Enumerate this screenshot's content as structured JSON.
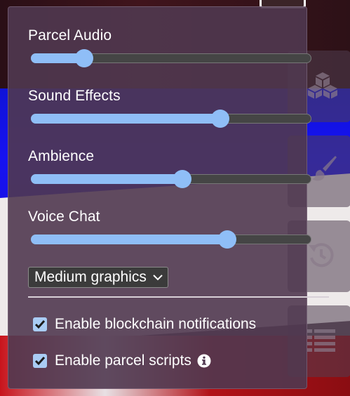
{
  "sliders": [
    {
      "label": "Parcel Audio",
      "value": 0.19
    },
    {
      "label": "Sound Effects",
      "value": 0.675
    },
    {
      "label": "Ambience",
      "value": 0.54
    },
    {
      "label": "Voice Chat",
      "value": 0.7
    }
  ],
  "graphics_select": {
    "value": "Medium graphics"
  },
  "checkboxes": [
    {
      "label": "Enable blockchain notifications",
      "checked": true
    },
    {
      "label": "Enable parcel scripts",
      "checked": true,
      "icon": "info-icon"
    }
  ],
  "toolbar": {
    "icons": [
      "cubes-icon",
      "paintbrush-icon",
      "history-icon",
      "list-icon"
    ]
  },
  "colors": {
    "accent": "#8fbef7",
    "panel": "#503850",
    "track": "#454545"
  }
}
